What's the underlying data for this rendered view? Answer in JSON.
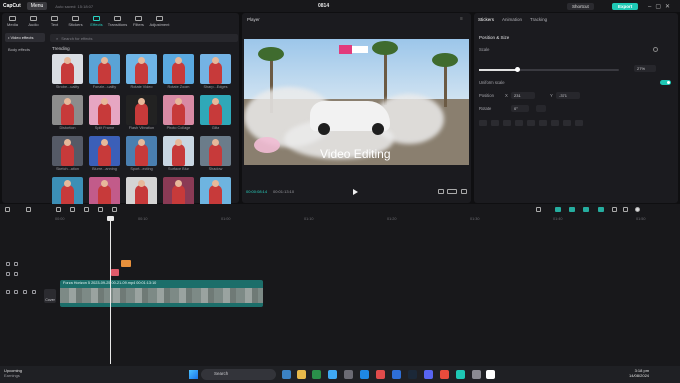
{
  "titlebar": {
    "app_logo": "CapCut",
    "menu_label": "Menu",
    "autosave": "Auto saved: 15:18:07",
    "project_name": "0814",
    "shortcut_label": "Shortcut",
    "export_label": "Export"
  },
  "media_tabs": [
    {
      "label": "Media",
      "icon": "media-icon"
    },
    {
      "label": "Audio",
      "icon": "audio-icon"
    },
    {
      "label": "Text",
      "icon": "text-icon"
    },
    {
      "label": "Stickers",
      "icon": "sticker-icon"
    },
    {
      "label": "Effects",
      "icon": "effects-icon",
      "active": true
    },
    {
      "label": "Transitions",
      "icon": "transitions-icon"
    },
    {
      "label": "Filters",
      "icon": "filters-icon"
    },
    {
      "label": "Adjustment",
      "icon": "adjustment-icon"
    }
  ],
  "effect_categories": [
    "• Video effects",
    "Body effects"
  ],
  "search": {
    "placeholder": "Search for effects"
  },
  "section_title": "Trending",
  "effects": [
    {
      "label": "Strobe...uality",
      "color": "#d9dde3"
    },
    {
      "label": "Fonzie...uality",
      "color": "#5aa3d6"
    },
    {
      "label": "Rotate Video",
      "color": "#6fb5e6"
    },
    {
      "label": "Rotate Zoom",
      "color": "#5aa9e0"
    },
    {
      "label": "Sharp...Edges",
      "color": "#74b3e4"
    },
    {
      "label": "Distortion",
      "color": "#8c8c8c"
    },
    {
      "label": "Split Frame",
      "color": "#e6a6c2"
    },
    {
      "label": "Flash Vibration",
      "color": "#222222"
    },
    {
      "label": "Photo Collage",
      "color": "#d88aa4"
    },
    {
      "label": "Glitz",
      "color": "#2fa8b8"
    },
    {
      "label": "Sketch...ation",
      "color": "#555a66"
    },
    {
      "label": "Blurre...anning",
      "color": "#3b5fb8"
    },
    {
      "label": "Sport...ecting",
      "color": "#4a7fb0"
    },
    {
      "label": "Surface Blur",
      "color": "#c8d6e2"
    },
    {
      "label": "Shadow",
      "color": "#6b7c8a"
    },
    {
      "label": "Lens Quality",
      "color": "#3c8fb6"
    },
    {
      "label": "",
      "color": "#c25b8a"
    },
    {
      "label": "",
      "color": "#d4d4d4"
    },
    {
      "label": "",
      "color": "#8a3a55"
    },
    {
      "label": "",
      "color": "#6eb4e0"
    },
    {
      "label": "",
      "color": "#b04a6a"
    }
  ],
  "player": {
    "title": "Player",
    "overlay_text": "Video Editing",
    "current_time": "00:00:08:14",
    "total_time": "00:01:13:10"
  },
  "right_tabs": [
    "Stickers",
    "Animation",
    "Tracking"
  ],
  "properties": {
    "section": "Position & Size",
    "scale_label": "Scale",
    "scale_value": "27%",
    "scale_fraction": 0.27,
    "uniform_label": "Uniform scale",
    "uniform_scale": true,
    "position_label": "Position",
    "pos_x_label": "X",
    "pos_x": "231",
    "pos_y_label": "Y",
    "pos_y": "-371",
    "rotate_label": "Rotate",
    "rotate_value": "0°"
  },
  "timeline": {
    "ruler": [
      "00:00",
      "00:10",
      "01:00",
      "01:10",
      "01:20",
      "01:30",
      "01:40",
      "01:50"
    ],
    "cover_label": "Cover",
    "clip_label": "Forza Horizon 5 2023-09-25 00-21-09.mp4   00:01:13:10"
  },
  "taskbar": {
    "weather_title": "Upcoming",
    "weather_sub": "Earnings",
    "search_placeholder": "Search",
    "time": "3:18 pm",
    "date": "14/08/2024"
  },
  "colors": {
    "accent": "#29d3c1",
    "export": "#1ec8b5"
  }
}
